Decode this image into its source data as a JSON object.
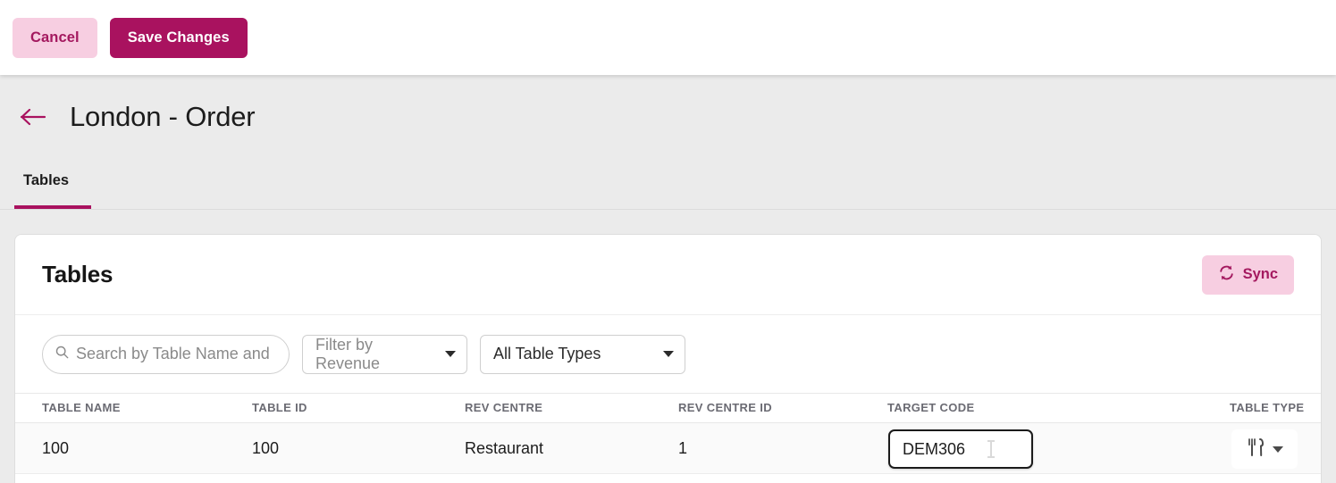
{
  "topbar": {
    "cancel_label": "Cancel",
    "save_label": "Save Changes"
  },
  "header": {
    "back_icon": "arrow-left-icon",
    "title": "London - Order",
    "tabs": [
      {
        "label": "Tables",
        "active": true
      }
    ]
  },
  "card": {
    "title": "Tables",
    "sync_label": "Sync",
    "sync_icon": "sync-icon"
  },
  "filters": {
    "search": {
      "icon": "search-icon",
      "value": "",
      "placeholder": "Search by Table Name and"
    },
    "revenue": {
      "label": "Filter by Revenue",
      "icon": "chevron-down-icon"
    },
    "table_type": {
      "label": "All Table Types",
      "icon": "chevron-down-icon"
    }
  },
  "table": {
    "columns": [
      "TABLE NAME",
      "TABLE ID",
      "REV CENTRE",
      "REV CENTRE ID",
      "TARGET CODE",
      "TABLE TYPE"
    ],
    "rows": [
      {
        "table_name": "100",
        "table_id": "100",
        "rev_centre": "Restaurant",
        "rev_centre_id": "1",
        "target_code": "DEM306",
        "table_type_icon": "cutlery-icon",
        "table_type_caret": "chevron-down-icon"
      }
    ]
  },
  "colors": {
    "brand": "#a9125f",
    "brand_light": "#f7cee1",
    "page_bg": "#ebebeb",
    "row_bg": "#fafafa"
  }
}
